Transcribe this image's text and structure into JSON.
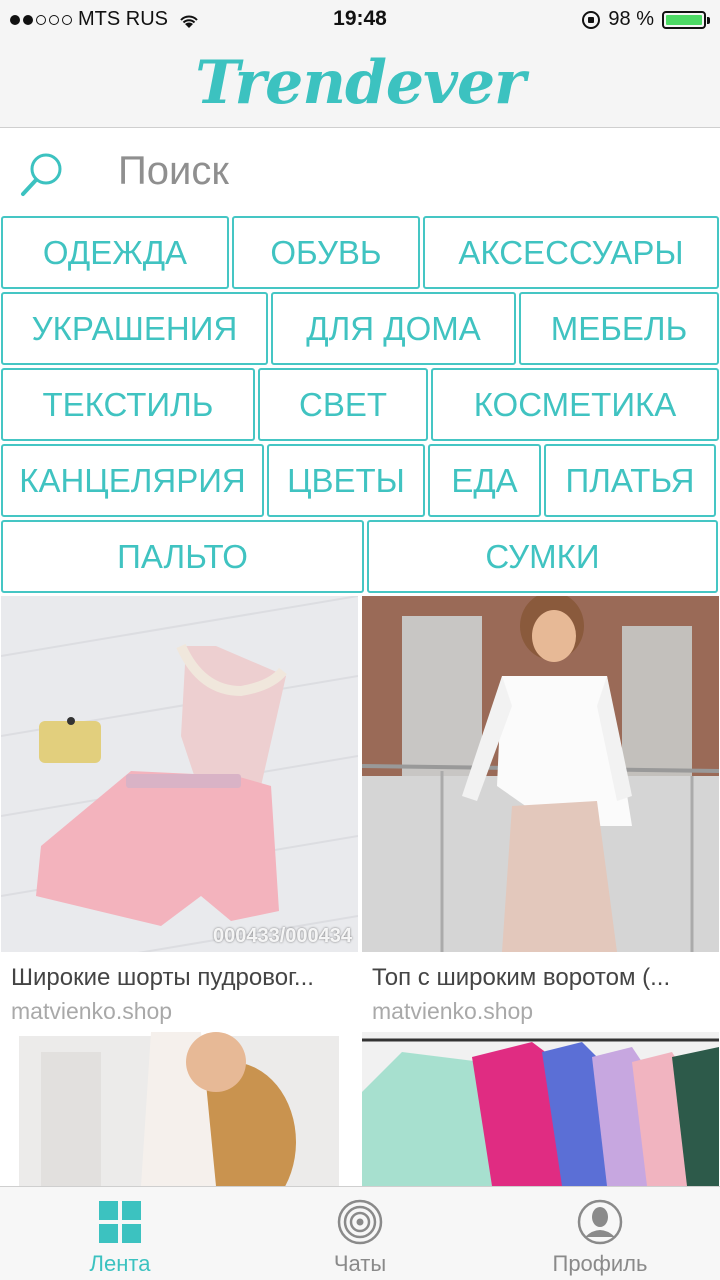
{
  "status_bar": {
    "carrier": "MTS RUS",
    "time": "19:48",
    "battery_text": "98 %"
  },
  "header": {
    "logo": "Trendever"
  },
  "search": {
    "placeholder": "Поиск"
  },
  "categories": [
    [
      "ОДЕЖДА",
      "ОБУВЬ",
      "АКСЕССУАРЫ"
    ],
    [
      "УКРАШЕНИЯ",
      "ДЛЯ ДОМА",
      "МЕБЕЛЬ"
    ],
    [
      "ТЕКСТИЛЬ",
      "СВЕТ",
      "КОСМЕТИКА"
    ],
    [
      "КАНЦЕЛЯРИЯ",
      "ЦВЕТЫ",
      "ЕДА",
      "ПЛАТЬЯ"
    ],
    [
      "ПАЛЬТО",
      "СУМКИ"
    ]
  ],
  "feed": {
    "items": [
      {
        "title": "Широкие шорты пудровог...",
        "shop": "matvienko.shop",
        "watermark": "000433/000434"
      },
      {
        "title": "Топ с широким воротом (...",
        "shop": "matvienko.shop"
      },
      {
        "title": "",
        "shop": ""
      },
      {
        "title": "",
        "shop": ""
      }
    ]
  },
  "tabbar": {
    "tabs": [
      {
        "label": "Лента",
        "icon": "grid-icon",
        "active": true
      },
      {
        "label": "Чаты",
        "icon": "chat-rings-icon",
        "active": false
      },
      {
        "label": "Профиль",
        "icon": "profile-icon",
        "active": false
      }
    ]
  },
  "colors": {
    "accent": "#3cc2c0",
    "battery": "#4cd964"
  }
}
